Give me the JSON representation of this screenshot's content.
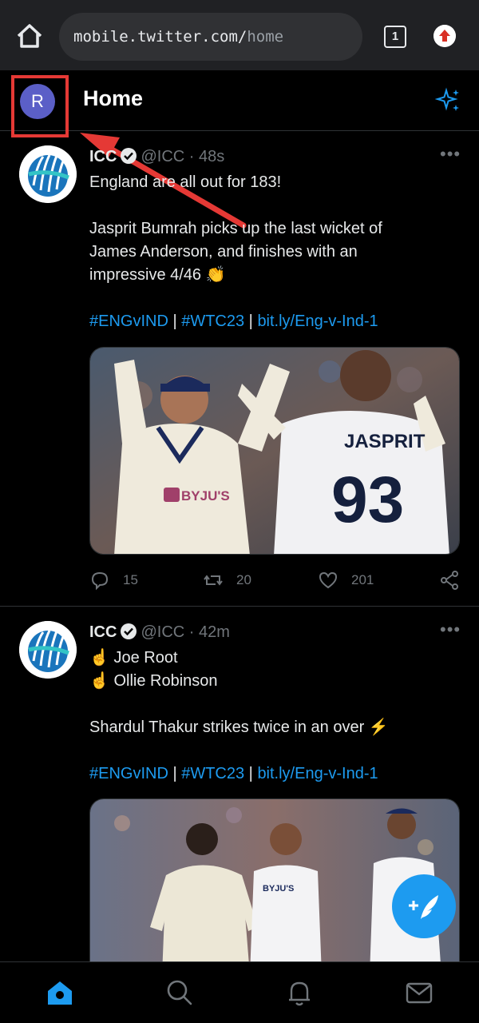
{
  "browser": {
    "url_host": "mobile.twitter.com/",
    "url_path": "home",
    "tab_count": "1"
  },
  "header": {
    "avatar_initial": "R",
    "title": "Home"
  },
  "tweets": [
    {
      "name": "ICC",
      "handle": "@ICC",
      "separator": "·",
      "time": "48s",
      "lines": [
        "England are all out for 183!",
        "",
        "Jasprit Bumrah picks up the last wicket of",
        "James Anderson, and finishes with an",
        "impressive 4/46 👏"
      ],
      "hashtags": {
        "tag1": "#ENGvIND",
        "sep1": " | ",
        "tag2": "#WTC23",
        "sep2": " | ",
        "link": "bit.ly/Eng-v-Ind-1"
      },
      "media": {
        "jersey_name": "JASPRIT",
        "jersey_number": "93",
        "sponsor": "BYJU'S"
      },
      "replies": "15",
      "retweets": "20",
      "likes": "201"
    },
    {
      "name": "ICC",
      "handle": "@ICC",
      "separator": "·",
      "time": "42m",
      "lines": [
        "☝️ Joe Root",
        "☝️ Ollie Robinson",
        "",
        "Shardul Thakur strikes twice in an over ⚡"
      ],
      "hashtags": {
        "tag1": "#ENGvIND",
        "sep1": " | ",
        "tag2": "#WTC23",
        "sep2": " | ",
        "link": "bit.ly/Eng-v-Ind-1"
      },
      "media": {
        "sponsor": "BYJU'S"
      }
    }
  ],
  "colors": {
    "accent": "#1d9bf0",
    "annotation": "#e53935",
    "background": "#000000"
  }
}
